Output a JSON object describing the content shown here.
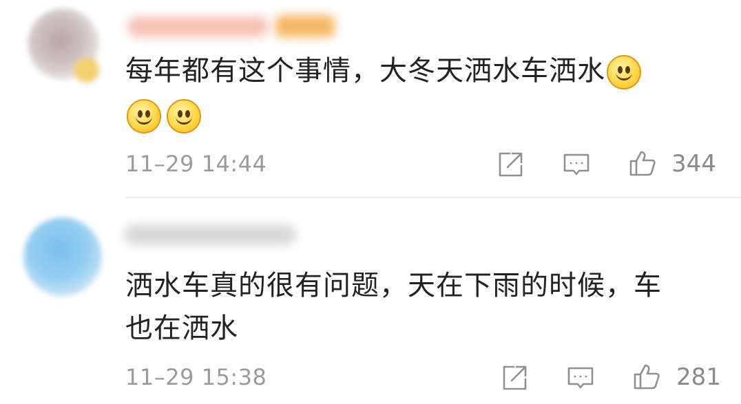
{
  "comments": [
    {
      "text_line1": "每年都有这个事情，大冬天洒水车洒水",
      "timestamp": "11–29 14:44",
      "like_count": "344",
      "emojis": [
        "smile-emoji",
        "smile-emoji",
        "smile-emoji"
      ]
    },
    {
      "text_line1": "洒水车真的很有问题，天在下雨的时候，车",
      "text_line2": "也在洒水",
      "timestamp": "11–29 15:38",
      "like_count": "281"
    }
  ],
  "icons": {
    "share": "share-icon",
    "reply": "reply-icon",
    "like": "like-icon"
  },
  "colors": {
    "text": "#222222",
    "meta": "#9a9a9a",
    "divider": "#ececec"
  }
}
